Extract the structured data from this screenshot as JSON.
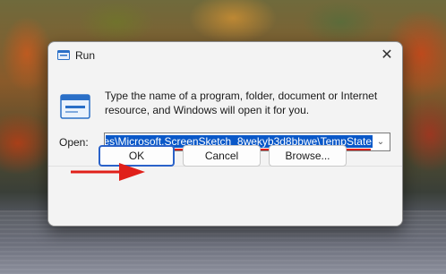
{
  "window": {
    "title": "Run",
    "close_glyph": "✕"
  },
  "dialog": {
    "description": "Type the name of a program, folder, document or Internet resource, and Windows will open it for you.",
    "open_label": "Open:",
    "open_value": "es\\Microsoft.ScreenSketch_8wekyb3d8bbwe\\TempState",
    "dropdown_glyph": "⌄"
  },
  "buttons": {
    "ok": "OK",
    "cancel": "Cancel",
    "browse": "Browse..."
  },
  "annotation": {
    "underline_color": "#e0201a",
    "arrow_color": "#e0201a"
  },
  "icons": {
    "title": "run-icon",
    "big": "run-large-icon",
    "close": "close-icon",
    "dropdown": "chevron-down-icon"
  }
}
